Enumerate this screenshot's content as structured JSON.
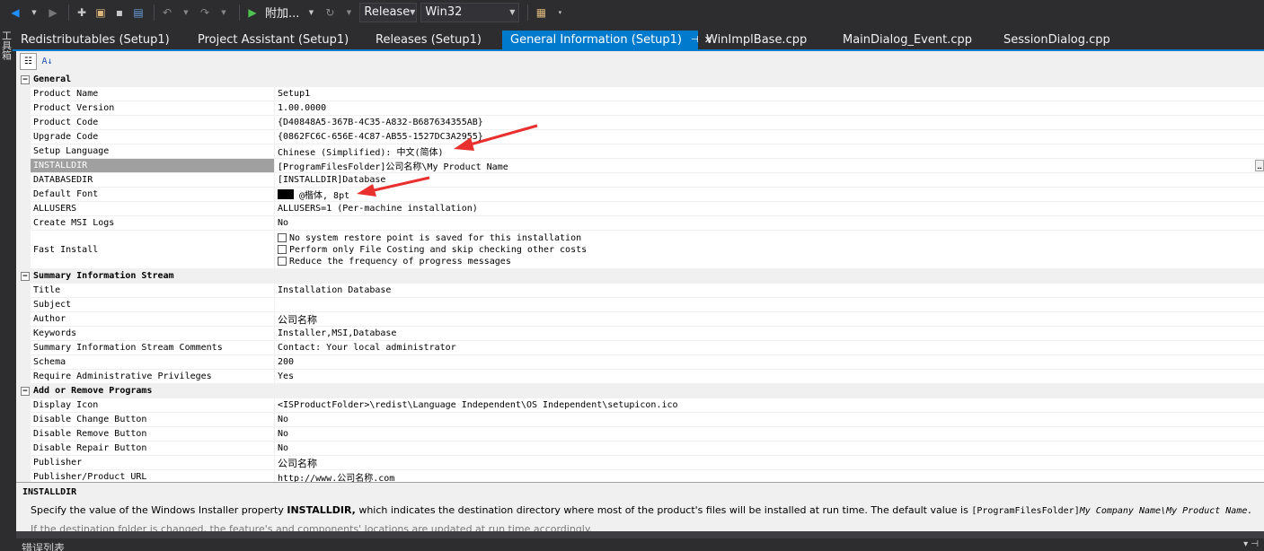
{
  "toolbar": {
    "attach_label": "附加...",
    "config_value": "Release",
    "platform_value": "Win32"
  },
  "toolbox_label": "工具箱",
  "tabs": [
    {
      "label": "Redistributables (Setup1)",
      "active": false
    },
    {
      "label": "Project Assistant (Setup1)",
      "active": false
    },
    {
      "label": "Releases (Setup1)",
      "active": false
    },
    {
      "label": "General Information (Setup1)",
      "active": true
    },
    {
      "label": "WinImplBase.cpp",
      "active": false
    },
    {
      "label": "MainDialog_Event.cpp",
      "active": false
    },
    {
      "label": "SessionDialog.cpp",
      "active": false
    }
  ],
  "active_tab_pin": "⊣",
  "active_tab_close": "✕",
  "prop_toolbar": {
    "categorized_glyph": "☷",
    "alpha_glyph": "A↓"
  },
  "groups": {
    "general": {
      "title": "General",
      "rows": {
        "product_name": {
          "name": "Product Name",
          "value": "Setup1"
        },
        "product_version": {
          "name": "Product Version",
          "value": "1.00.0000"
        },
        "product_code": {
          "name": "Product Code",
          "value": "{D40848A5-367B-4C35-A832-B687634355AB}"
        },
        "upgrade_code": {
          "name": "Upgrade Code",
          "value": "{0862FC6C-656E-4C87-AB55-1527DC3A2955}"
        },
        "setup_language": {
          "name": "Setup Language",
          "value": "Chinese (Simplified): 中文(简体)"
        },
        "installdir": {
          "name": "INSTALLDIR",
          "value": "[ProgramFilesFolder]公司名称\\My Product Name"
        },
        "databasedir": {
          "name": "DATABASEDIR",
          "value": "[INSTALLDIR]Database"
        },
        "default_font": {
          "name": "Default Font",
          "value": "@楷体, 8pt"
        },
        "allusers": {
          "name": "ALLUSERS",
          "value": "ALLUSERS=1 (Per-machine installation)"
        },
        "create_msi_logs": {
          "name": "Create MSI Logs",
          "value": "No"
        },
        "fast_install": {
          "name": "Fast Install",
          "options": [
            "No system restore point is saved for this installation",
            "Perform only File Costing and skip checking other costs",
            "Reduce the frequency of progress messages"
          ]
        }
      }
    },
    "summary": {
      "title": "Summary Information Stream",
      "rows": {
        "title": {
          "name": "Title",
          "value": "Installation Database"
        },
        "subject": {
          "name": "Subject",
          "value": ""
        },
        "author": {
          "name": "Author",
          "value": "公司名称"
        },
        "keywords": {
          "name": "Keywords",
          "value": "Installer,MSI,Database"
        },
        "comments": {
          "name": "Summary Information Stream Comments",
          "value": "Contact:  Your local administrator"
        },
        "schema": {
          "name": "Schema",
          "value": "200"
        },
        "require_admin": {
          "name": "Require Administrative Privileges",
          "value": "Yes"
        }
      }
    },
    "arp": {
      "title": "Add or Remove Programs",
      "rows": {
        "display_icon": {
          "name": "Display Icon",
          "value": "<ISProductFolder>\\redist\\Language Independent\\OS Independent\\setupicon.ico"
        },
        "disable_change": {
          "name": "Disable Change Button",
          "value": "No"
        },
        "disable_remove": {
          "name": "Disable Remove Button",
          "value": "No"
        },
        "disable_repair": {
          "name": "Disable Repair Button",
          "value": "No"
        },
        "publisher": {
          "name": "Publisher",
          "value": "公司名称"
        },
        "publisher_url": {
          "name": "Publisher/Product URL",
          "value": "http://www.公司名称.com"
        }
      }
    }
  },
  "description": {
    "title": "INSTALLDIR",
    "text_before": "Specify the value of the Windows Installer property ",
    "text_bold": "INSTALLDIR,",
    "text_middle": " which indicates the destination directory where most of the product's files will be installed at run time. The default value is ",
    "text_mono": "[ProgramFilesFolder]",
    "text_mono_italic": "My Company Name\\My Product Name.",
    "faint_line": "If the destination folder is changed, the feature's and components' locations are updated at run time accordingly."
  },
  "bottom_panel": {
    "title": "错误列表",
    "pin": "▾ ⊣"
  },
  "colors": {
    "vs_dark": "#2d2d30",
    "accent_blue": "#007acc",
    "annotation_red": "#e8312f",
    "selected_row": "#a0a0a0"
  }
}
